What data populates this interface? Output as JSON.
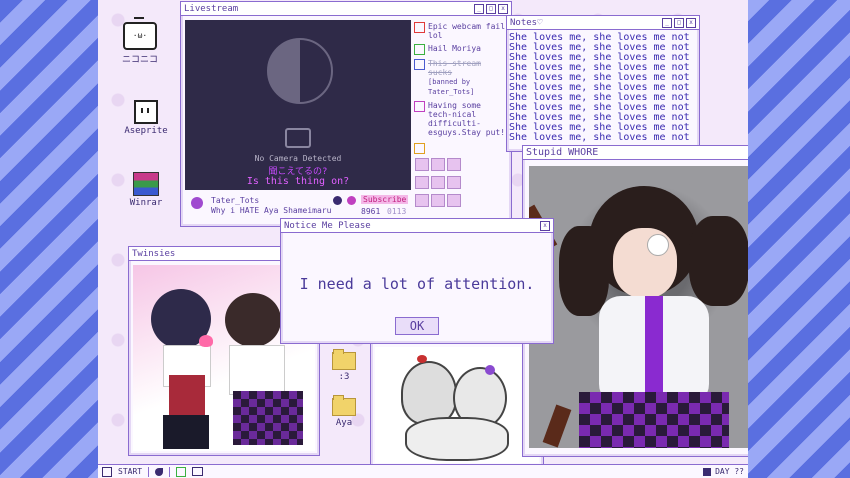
{
  "desktop": {
    "icons": [
      {
        "label": "ニコニコ",
        "name": "niconico"
      },
      {
        "label": "Aseprite",
        "name": "aseprite"
      },
      {
        "label": "Winrar",
        "name": "winrar"
      },
      {
        "label": ":3",
        "name": "folder-3"
      },
      {
        "label": "Aya",
        "name": "folder-aya"
      }
    ]
  },
  "livestream": {
    "title": "Livestream",
    "no_camera": "No Camera Detected",
    "jp_line": "聞こえてるの?",
    "caption": "Is this thing on?",
    "streamer": "Tater_Tots",
    "stream_title": "Why i HATE Aya Shameimaru",
    "subscribe": "Subscribe",
    "viewers": "8961",
    "time": "0113",
    "chat": [
      {
        "text": "Epic webcam fail lol",
        "color": "#e03a3a"
      },
      {
        "text": "Hail Moriya",
        "color": "#3ab040"
      },
      {
        "text": "This stream sucks",
        "color": "#4a5ad0",
        "struck": true,
        "note": "[banned by Tater_Tots]"
      },
      {
        "text": "Having some tech-nical difficulti-esguys.Stay put!",
        "color": "#c040c0"
      }
    ]
  },
  "notes": {
    "title": "Notes♡",
    "line": "She loves me, she loves me not",
    "count": 11
  },
  "stupid_window": {
    "title": "Stupid WHORE"
  },
  "twinsies": {
    "title": "Twinsies"
  },
  "dialog": {
    "title": "Notice Me Please",
    "message": "I need a lot of attention.",
    "ok": "OK"
  },
  "taskbar": {
    "start": "START",
    "clock": "DAY ??"
  }
}
